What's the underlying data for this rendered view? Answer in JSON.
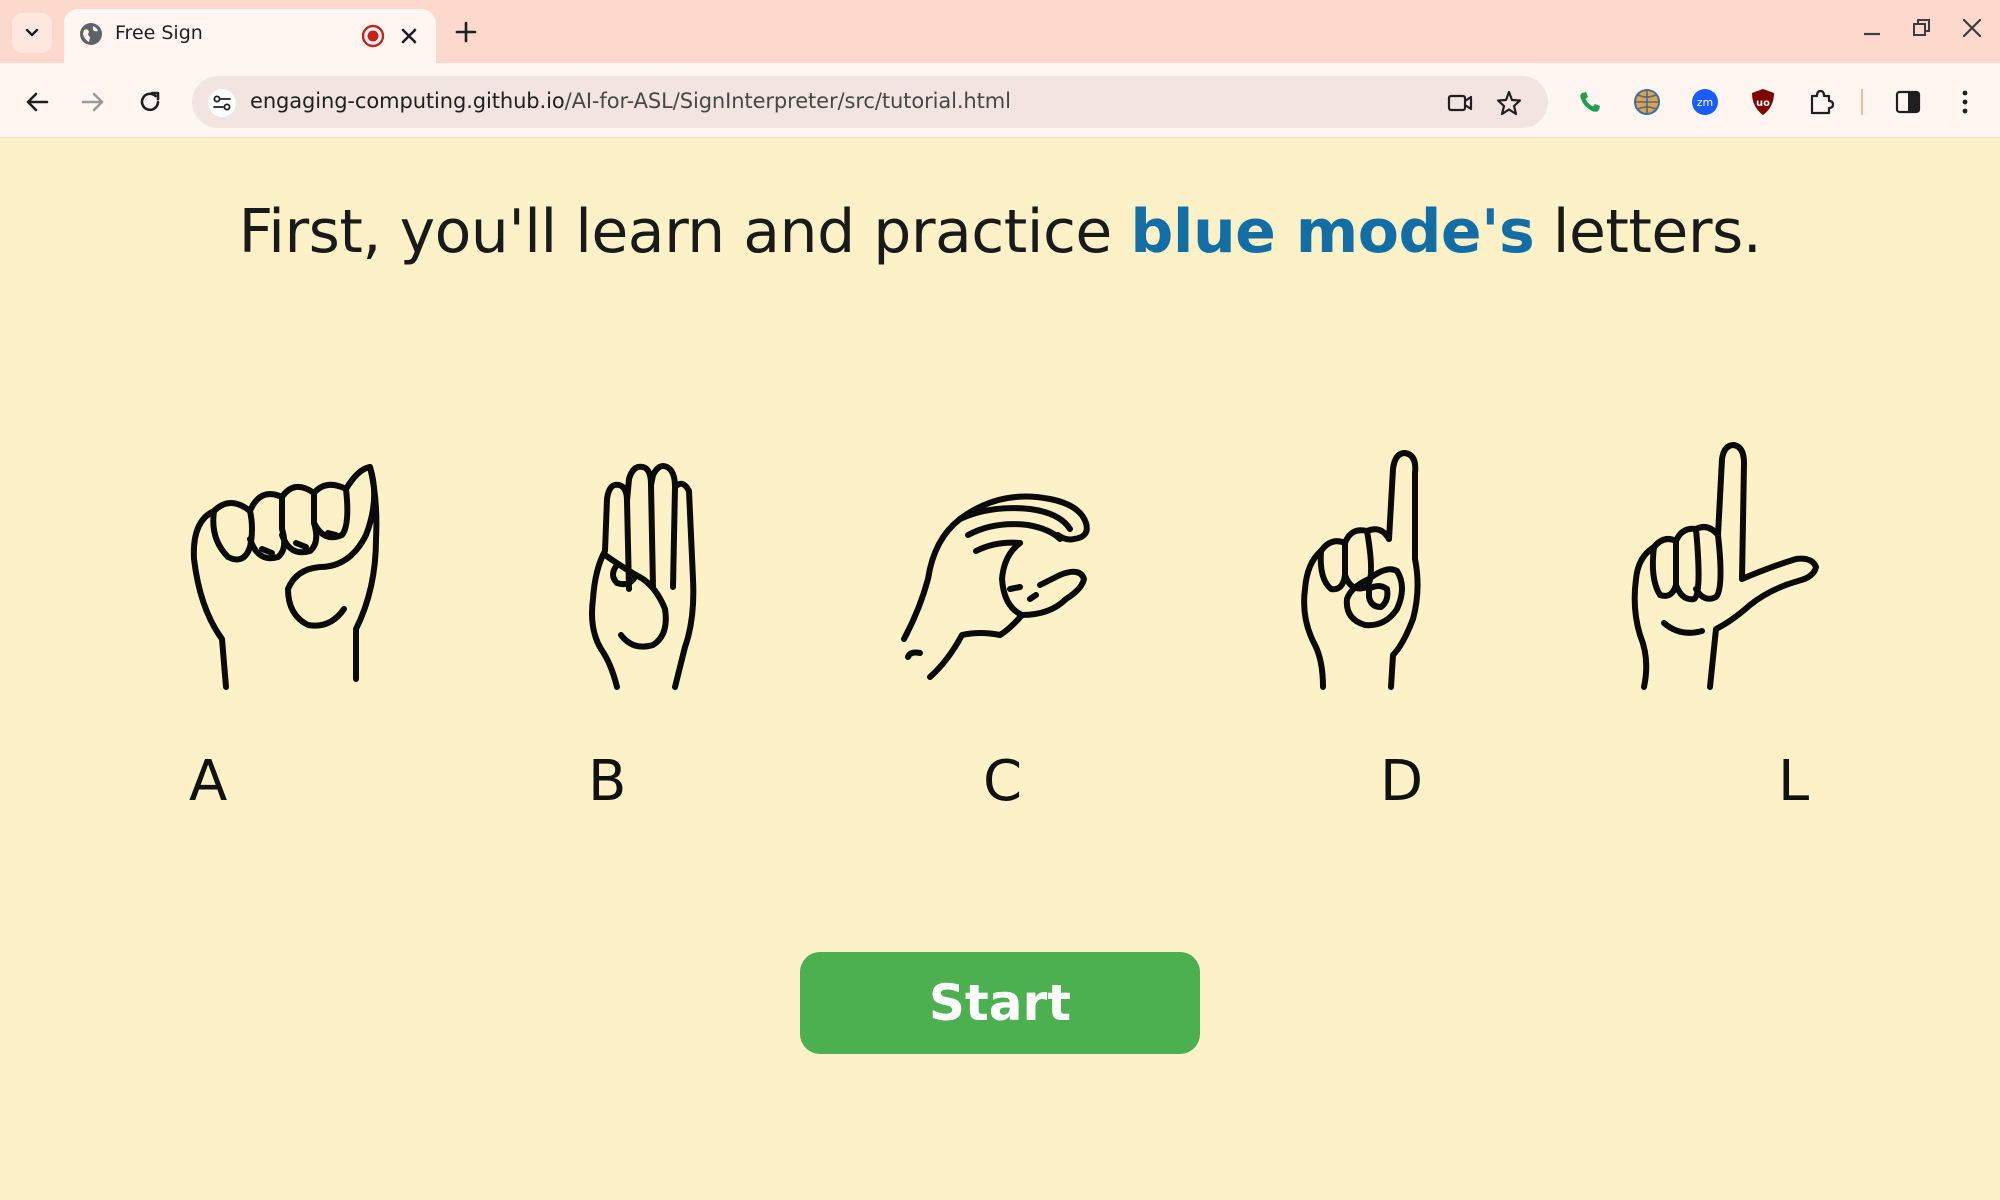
{
  "browser": {
    "tab": {
      "title": "Free Sign"
    },
    "url": {
      "host": "engaging-computing.github.io",
      "path": "/AI-for-ASL/SignInterpreter/src/tutorial.html"
    },
    "colors": {
      "tabstrip": "#fcd9cc",
      "toolbar": "#fff6f2",
      "omnibox": "#f2e4e0"
    }
  },
  "page": {
    "headline": {
      "before": "First, you'll learn and practice ",
      "highlight": "blue mode's",
      "after": " letters."
    },
    "letters": [
      {
        "label": "A",
        "icon": "asl-a-hand-icon"
      },
      {
        "label": "B",
        "icon": "asl-b-hand-icon"
      },
      {
        "label": "C",
        "icon": "asl-c-hand-icon"
      },
      {
        "label": "D",
        "icon": "asl-d-hand-icon"
      },
      {
        "label": "L",
        "icon": "asl-l-hand-icon"
      }
    ],
    "start_label": "Start",
    "colors": {
      "background": "#fdf2c7",
      "highlight": "#136ea6",
      "start_button": "#4caf50"
    }
  }
}
